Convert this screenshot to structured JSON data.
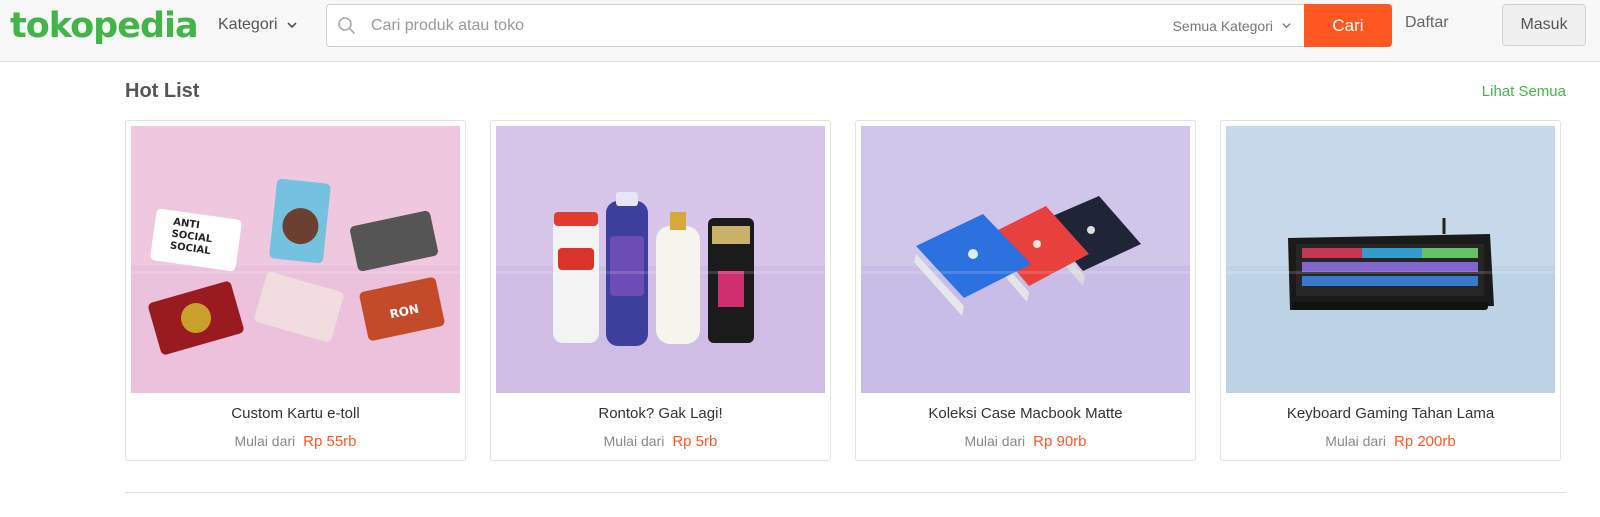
{
  "header": {
    "logo": "tokopedia",
    "kategori_label": "Kategori",
    "search": {
      "placeholder": "Cari produk atau toko",
      "category_selected": "Semua Kategori",
      "submit_label": "Cari"
    },
    "daftar_label": "Daftar",
    "masuk_label": "Masuk"
  },
  "hotlist": {
    "title": "Hot List",
    "see_all": "Lihat Semua",
    "price_prefix": "Mulai dari",
    "items": [
      {
        "title": "Custom Kartu e-toll",
        "price": "Rp 55rb",
        "bg": "#efc8e0"
      },
      {
        "title": "Rontok? Gak Lagi!",
        "price": "Rp 5rb",
        "bg": "#d7c6ea"
      },
      {
        "title": "Koleksi Case Macbook Matte",
        "price": "Rp 90rb",
        "bg": "#cfc6ea"
      },
      {
        "title": "Keyboard Gaming Tahan Lama",
        "price": "Rp 200rb",
        "bg": "#c6d8ea"
      }
    ]
  },
  "colors": {
    "brand_green": "#42b549",
    "accent_orange": "#ff5722"
  }
}
